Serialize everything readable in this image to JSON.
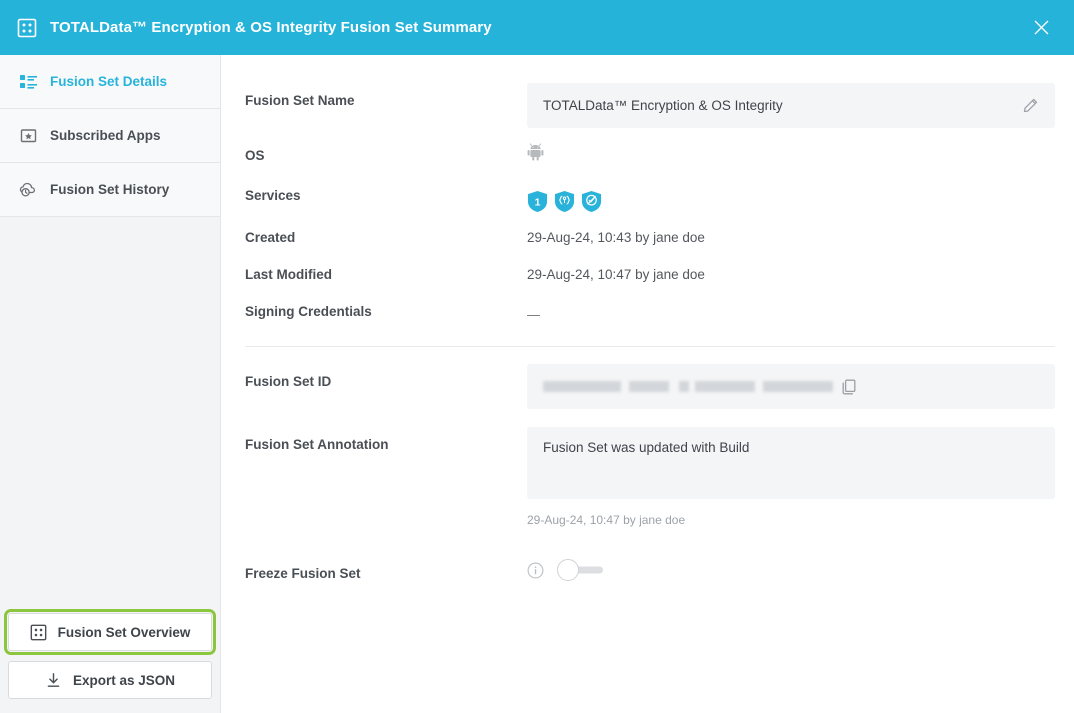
{
  "header": {
    "title": "TOTALData™ Encryption & OS Integrity Fusion Set Summary",
    "icon": "grid-dashboard-icon",
    "close_icon": "close-icon",
    "background_color": "#26b3d9"
  },
  "sidebar": {
    "items": [
      {
        "label": "Fusion Set Details",
        "icon": "list-details-icon",
        "active": true
      },
      {
        "label": "Subscribed Apps",
        "icon": "star-box-icon",
        "active": false
      },
      {
        "label": "Fusion Set History",
        "icon": "cloud-history-icon",
        "active": false
      }
    ],
    "actions": [
      {
        "label": "Fusion Set Overview",
        "icon": "grid-overview-icon",
        "focused": true,
        "focus_color": "#8cc63e"
      },
      {
        "label": "Export as JSON",
        "icon": "download-icon",
        "focused": false
      }
    ]
  },
  "main": {
    "fusion_set_name": {
      "label": "Fusion Set Name",
      "value": "TOTALData™ Encryption & OS Integrity",
      "edit_icon": "pencil-edit-icon"
    },
    "os": {
      "label": "OS",
      "icon": "android-os-icon",
      "value": ""
    },
    "services": {
      "label": "Services",
      "badges": [
        {
          "name": "service-badge-one",
          "glyph": "1"
        },
        {
          "name": "service-badge-code",
          "glyph": "{§}"
        },
        {
          "name": "service-badge-check",
          "glyph": "✓"
        }
      ],
      "badge_color": "#29b3db"
    },
    "created": {
      "label": "Created",
      "value": "29-Aug-24, 10:43 by jane doe"
    },
    "last_modified": {
      "label": "Last Modified",
      "value": "29-Aug-24, 10:47 by jane doe"
    },
    "signing_credentials": {
      "label": "Signing Credentials",
      "value": "—"
    },
    "fusion_set_id": {
      "label": "Fusion Set ID",
      "value": "",
      "redacted": true,
      "copy_icon": "copy-icon"
    },
    "fusion_set_annotation": {
      "label": "Fusion Set Annotation",
      "value": "Fusion Set was updated with Build",
      "timestamp": "29-Aug-24, 10:47 by jane doe"
    },
    "freeze_fusion_set": {
      "label": "Freeze Fusion Set",
      "info_icon": "info-circle-icon",
      "toggle_state": "off"
    }
  }
}
